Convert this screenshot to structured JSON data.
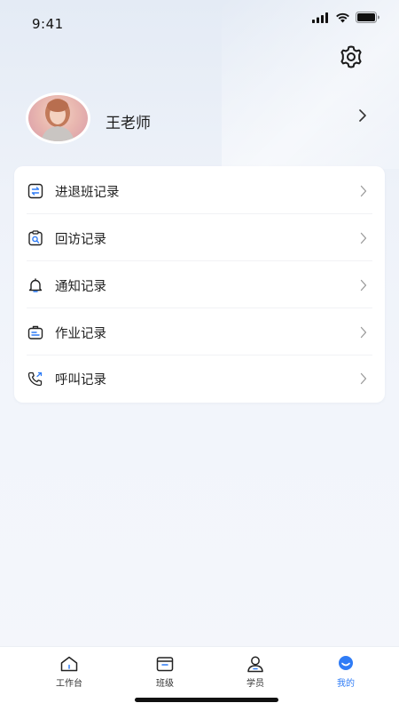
{
  "status_bar": {
    "time": "9:41"
  },
  "profile": {
    "name": "王老师"
  },
  "menu": {
    "items": [
      {
        "label": "进退班记录",
        "icon": "swap-icon"
      },
      {
        "label": "回访记录",
        "icon": "clipboard-search-icon"
      },
      {
        "label": "通知记录",
        "icon": "bell-icon"
      },
      {
        "label": "作业记录",
        "icon": "briefcase-icon"
      },
      {
        "label": "呼叫记录",
        "icon": "phone-icon"
      }
    ]
  },
  "tab_bar": {
    "tabs": [
      {
        "label": "工作台",
        "icon": "home-icon",
        "active": false
      },
      {
        "label": "班级",
        "icon": "class-icon",
        "active": false
      },
      {
        "label": "学员",
        "icon": "student-icon",
        "active": false
      },
      {
        "label": "我的",
        "icon": "profile-icon",
        "active": true
      }
    ]
  },
  "colors": {
    "accent": "#2f7cf6",
    "text": "#1f1f1f",
    "card": "#ffffff"
  }
}
